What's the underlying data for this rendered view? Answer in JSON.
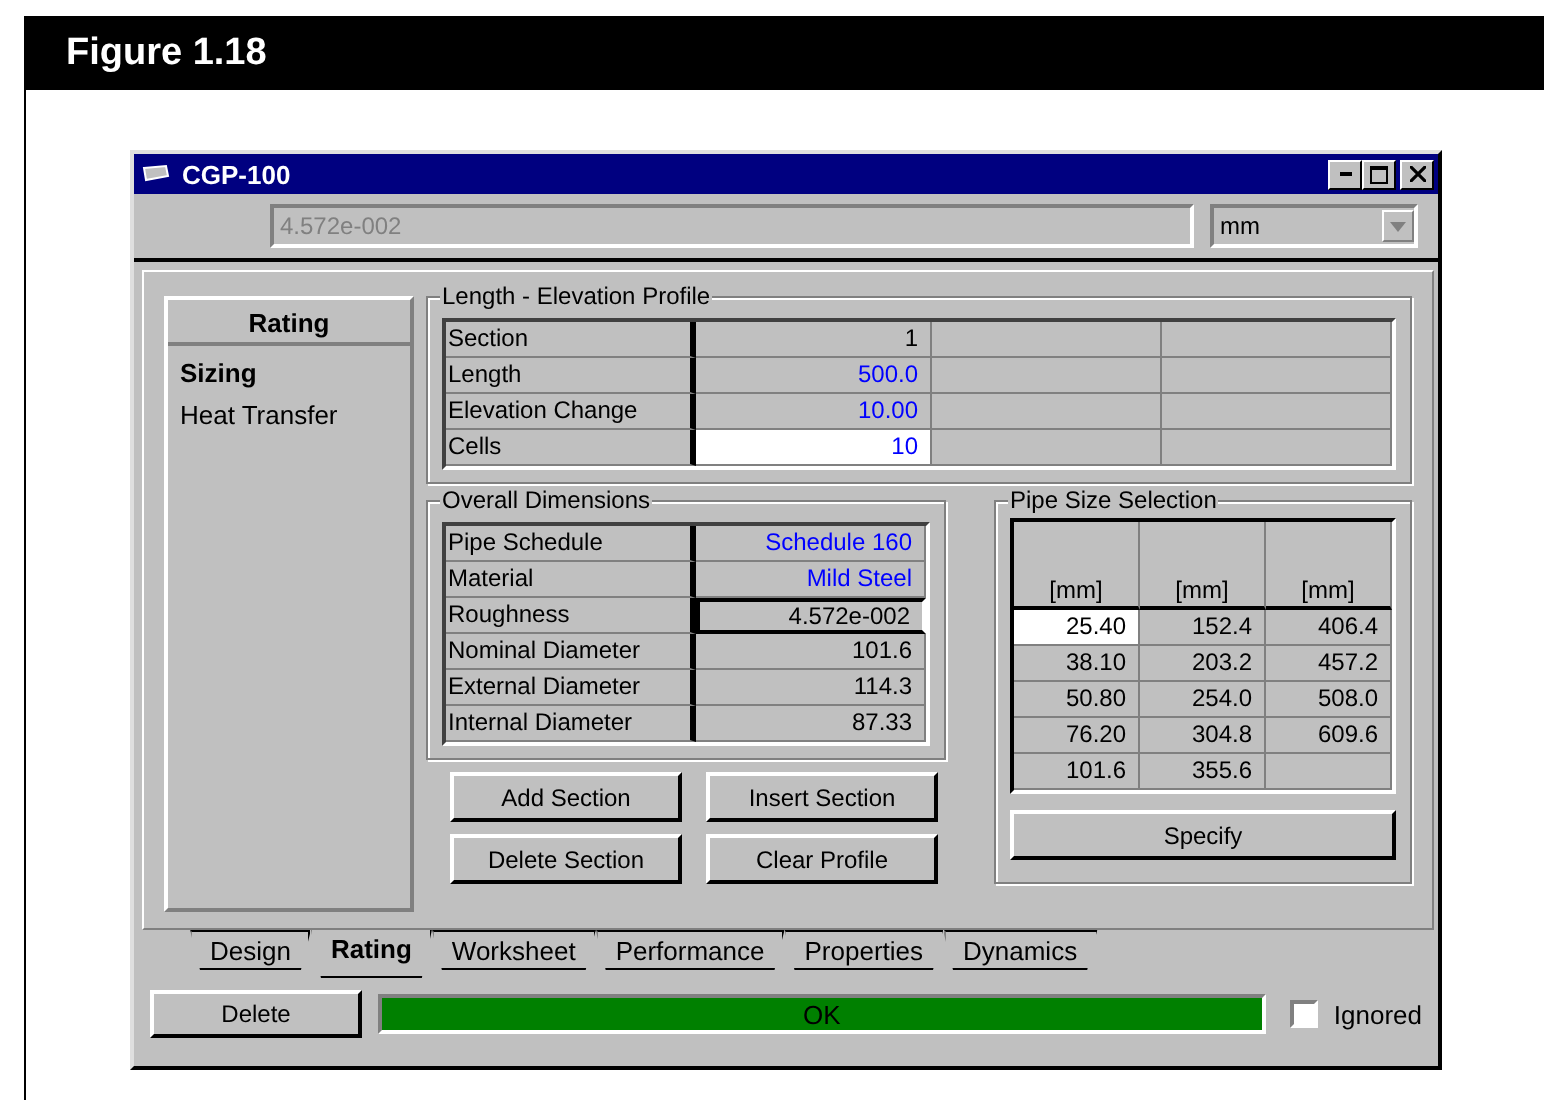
{
  "figure": {
    "caption": "Figure 1.18"
  },
  "window": {
    "title": "CGP-100"
  },
  "toolbar": {
    "value": "4.572e-002",
    "disabled": true,
    "unit": "mm"
  },
  "sidebar": {
    "header": "Rating",
    "items": [
      {
        "label": "Sizing",
        "selected": true
      },
      {
        "label": "Heat Transfer",
        "selected": false
      }
    ]
  },
  "profile": {
    "title": "Length - Elevation Profile",
    "rows": [
      {
        "label": "Section",
        "value": "1",
        "specified": false,
        "selected": false
      },
      {
        "label": "Length",
        "value": "500.0",
        "specified": true,
        "selected": false
      },
      {
        "label": "Elevation Change",
        "value": "10.00",
        "specified": true,
        "selected": false
      },
      {
        "label": "Cells",
        "value": "10",
        "specified": true,
        "selected": true
      }
    ]
  },
  "dimensions": {
    "title": "Overall Dimensions",
    "rows": [
      {
        "label": "Pipe Schedule",
        "value": "Schedule 160",
        "specified": true,
        "selected": false
      },
      {
        "label": "Material",
        "value": "Mild Steel",
        "specified": true,
        "selected": false
      },
      {
        "label": "Roughness",
        "value": "4.572e-002",
        "specified": false,
        "selected": true
      },
      {
        "label": "Nominal Diameter",
        "value": "101.6",
        "specified": false,
        "selected": false
      },
      {
        "label": "External Diameter",
        "value": "114.3",
        "specified": false,
        "selected": false
      },
      {
        "label": "Internal Diameter",
        "value": "87.33",
        "specified": false,
        "selected": false
      }
    ]
  },
  "buttons": [
    "Add Section",
    "Insert Section",
    "Delete Section",
    "Clear Profile"
  ],
  "pipe_sizes": {
    "title": "Pipe Size Selection",
    "columns": [
      "[mm]",
      "[mm]",
      "[mm]"
    ],
    "rows": [
      [
        {
          "value": "25.40",
          "selected": true
        },
        {
          "value": "152.4",
          "selected": false
        },
        {
          "value": "406.4",
          "selected": false
        }
      ],
      [
        {
          "value": "38.10",
          "selected": false
        },
        {
          "value": "203.2",
          "selected": false
        },
        {
          "value": "457.2",
          "selected": false
        }
      ],
      [
        {
          "value": "50.80",
          "selected": false
        },
        {
          "value": "254.0",
          "selected": false
        },
        {
          "value": "508.0",
          "selected": false
        }
      ],
      [
        {
          "value": "76.20",
          "selected": false
        },
        {
          "value": "304.8",
          "selected": false
        },
        {
          "value": "609.6",
          "selected": false
        }
      ],
      [
        {
          "value": "101.6",
          "selected": false
        },
        {
          "value": "355.6",
          "selected": false
        }
      ]
    ],
    "button": "Specify"
  },
  "tabs": [
    {
      "label": "Design",
      "selected": false
    },
    {
      "label": "Rating",
      "selected": true
    },
    {
      "label": "Worksheet",
      "selected": false
    },
    {
      "label": "Performance",
      "selected": false
    },
    {
      "label": "Properties",
      "selected": false
    },
    {
      "label": "Dynamics",
      "selected": false
    }
  ],
  "footer": {
    "delete": "Delete",
    "status": "OK",
    "ignored": {
      "label": "Ignored",
      "checked": false
    }
  }
}
